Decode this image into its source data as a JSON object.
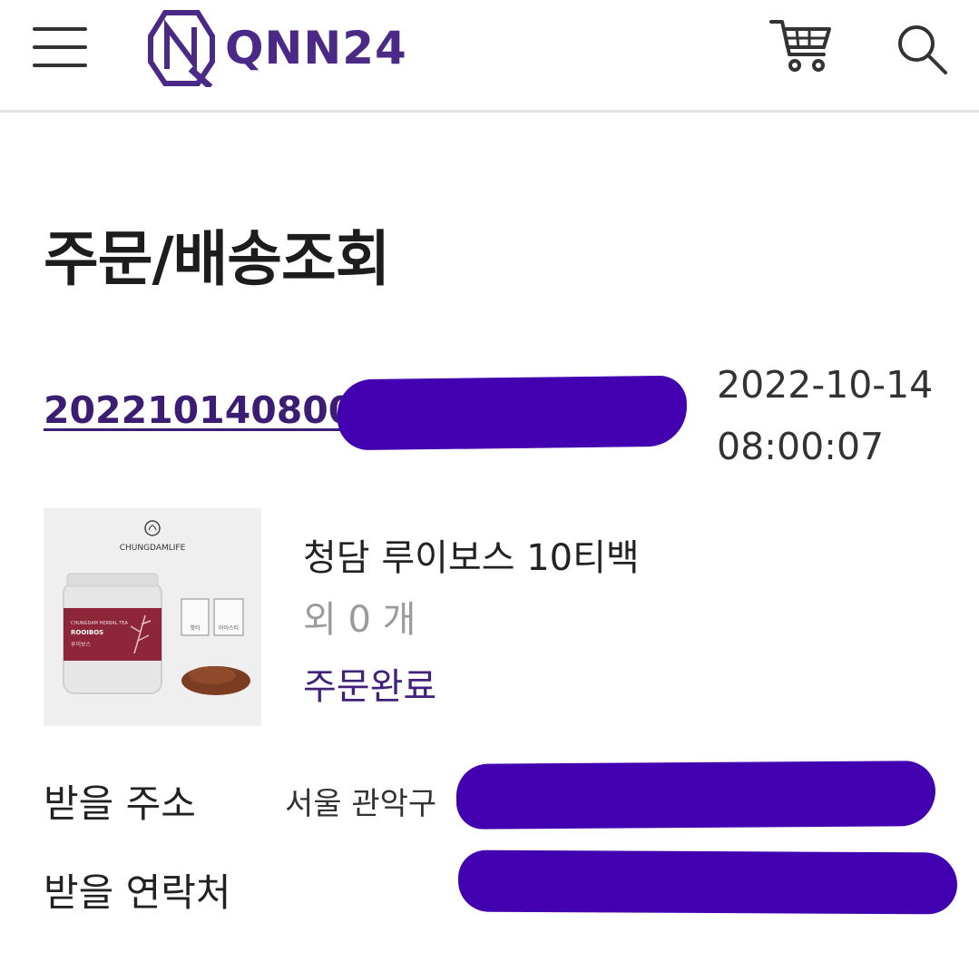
{
  "header": {
    "brand_name": "QNN24",
    "brand_color": "#4a2a86",
    "menu_icon": "hamburger-menu-icon",
    "cart_icon": "cart-icon",
    "search_icon": "search-icon"
  },
  "page": {
    "title": "주문/배송조회"
  },
  "order": {
    "number_visible": "2022101408000",
    "date": "2022-10-14",
    "time": "08:00:07",
    "product": {
      "name": "청담 루이보스 10티백",
      "extra_count": "외 0 개",
      "status": "주문완료",
      "thumbnail": {
        "brand": "CHUNGDAMLIFE",
        "line": "CHUNGDAM HERBAL TEA",
        "product": "ROOIBOS",
        "product_kr": "루이보스",
        "icon1_label": "핫티",
        "icon2_label": "아이스티"
      }
    }
  },
  "delivery": {
    "address_label": "받을 주소",
    "address_value": "서울 관악구",
    "phone_label": "받을 연락처"
  },
  "colors": {
    "accent": "#42217c",
    "redaction": "#4300b0",
    "status": "#42217c"
  }
}
